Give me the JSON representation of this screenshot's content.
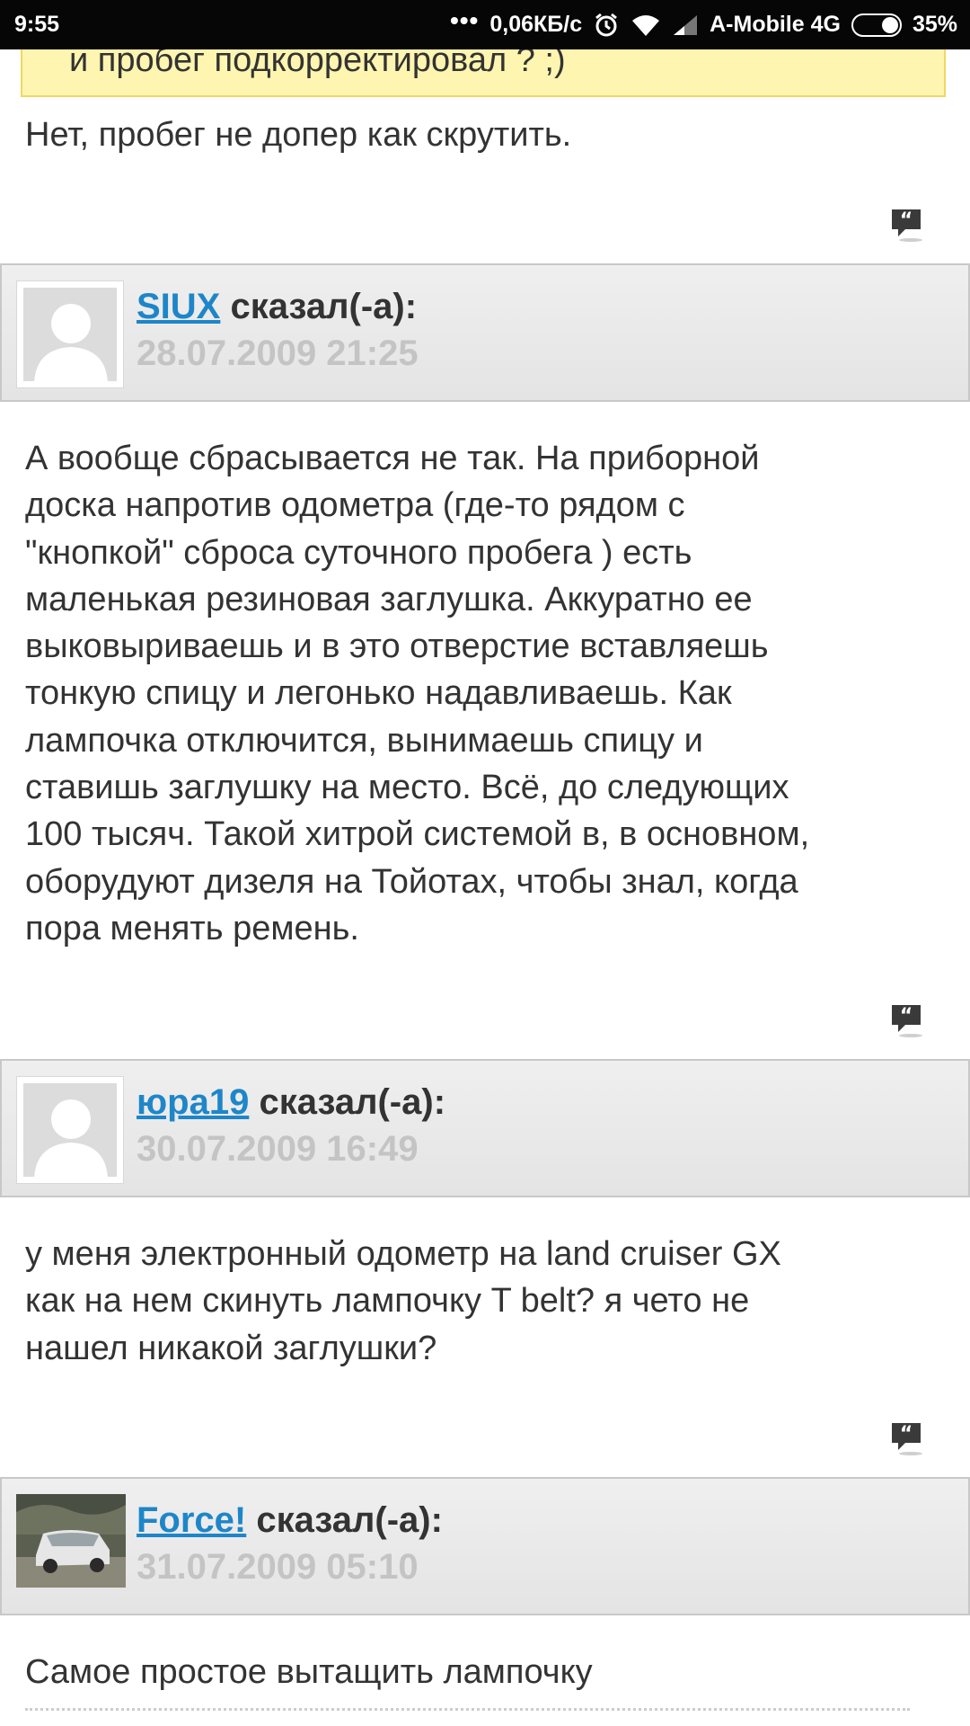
{
  "status_bar": {
    "time": "9:55",
    "dots": "•••",
    "speed": "0,06КБ/с",
    "carrier": "A-Mobile 4G",
    "battery": "35%",
    "battery_level": 0.35
  },
  "quote": {
    "text": "и пробег подкорректировал ? ;)"
  },
  "posts": [
    {
      "body": [
        "Нет, пробег не допер как скрутить."
      ]
    },
    {
      "author": "SIUX",
      "said": "сказал(-а):",
      "date": "28.07.2009 21:25",
      "body": [
        "А вообще сбрасывается не так. На приборной",
        "доска напротив одометра (где-то рядом с",
        "\"кнопкой\" сброса суточного пробега ) есть",
        "маленькая резиновая заглушка. Аккуратно ее",
        "выковыриваешь и в это отверстие вставляешь",
        "тонкую спицу и легонько надавливаешь. Как",
        "лампочка отключится, вынимаешь спицу и",
        "ставишь заглушку на место. Всё, до следующих",
        "100 тысяч. Такой хитрой системой в, в основном,",
        "оборудуют дизеля на Тойотах, чтобы знал, когда",
        "пора менять ремень."
      ]
    },
    {
      "author": "юра19",
      "said": "сказал(-а):",
      "date": "30.07.2009 16:49",
      "body": [
        "у меня электронный одометр на land cruiser GX",
        "как на нем скинуть лампочку T belt? я чето не",
        "нашел никакой заглушки?"
      ]
    },
    {
      "author": "Force!",
      "said": "сказал(-а):",
      "date": "31.07.2009 05:10",
      "body": [
        "Самое простое вытащить лампочку"
      ]
    }
  ],
  "icons": {
    "reply": "quote-reply-icon",
    "avatar_default": "default-avatar-icon",
    "avatar_photo": "car-photo-avatar"
  },
  "colors": {
    "link": "#1e86c8",
    "date": "#c4c4c4",
    "quote_bg": "#fdf5b0",
    "header_bg": "#e9e9e9"
  }
}
